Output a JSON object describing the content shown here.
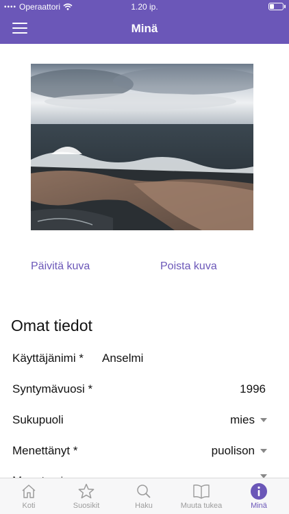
{
  "status": {
    "carrier": "Operaattori",
    "time": "1.20 ip."
  },
  "nav": {
    "title": "Minä"
  },
  "photo_actions": {
    "update_label": "Päivitä kuva",
    "remove_label": "Poista kuva"
  },
  "section": {
    "title": "Omat tiedot"
  },
  "fields": [
    {
      "label": "Käyttäjänimi *",
      "value": "Anselmi"
    },
    {
      "label": "Syntymävuosi *",
      "value": "1996"
    },
    {
      "label": "Sukupuoli",
      "value": "mies"
    },
    {
      "label": "Menettänyt *",
      "value": "puolison"
    },
    {
      "label": "Menetys *",
      "value": ""
    }
  ],
  "tabs": [
    {
      "label": "Koti",
      "icon": "home-icon"
    },
    {
      "label": "Suosikit",
      "icon": "star-icon"
    },
    {
      "label": "Haku",
      "icon": "search-icon"
    },
    {
      "label": "Muuta tukea",
      "icon": "book-icon"
    },
    {
      "label": "Minä",
      "icon": "info-icon"
    }
  ],
  "colors": {
    "accent": "#6b57b8",
    "tab_inactive": "#9b9b9b"
  }
}
